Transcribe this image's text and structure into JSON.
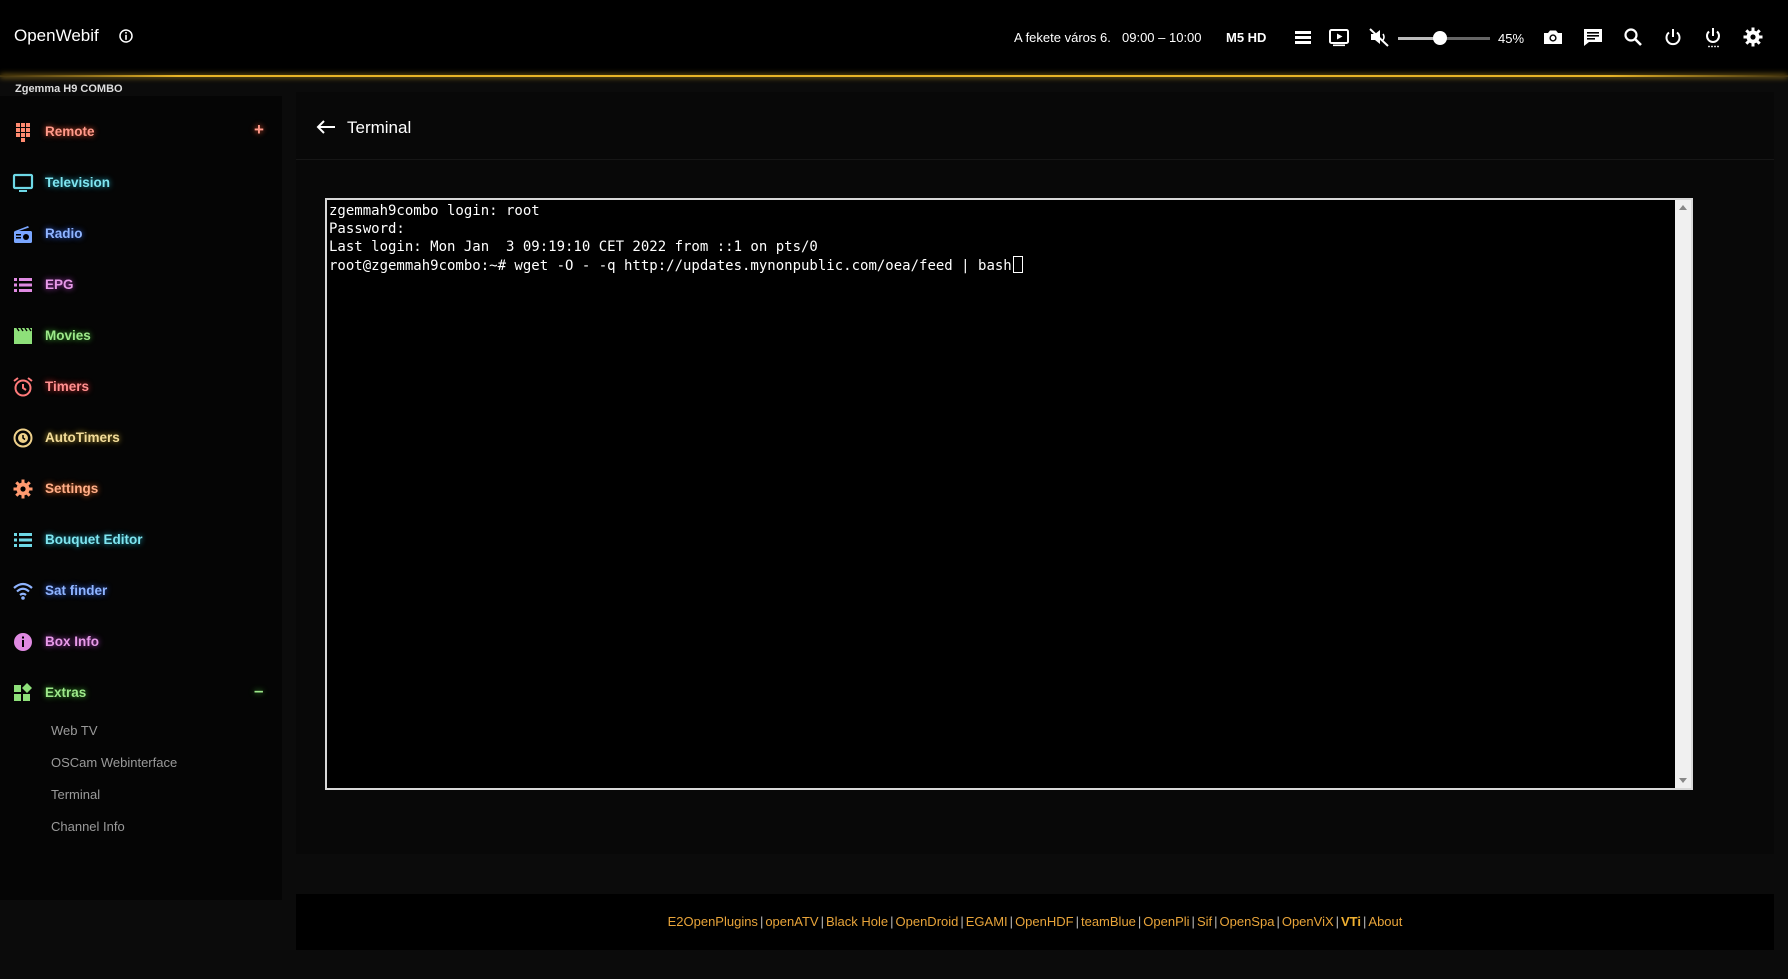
{
  "topbar": {
    "brand": "OpenWebif",
    "now_program": "A fekete város 6.",
    "now_time": "09:00 – 10:00",
    "channel": "M5 HD",
    "volume_percent": 45,
    "volume_label": "45%",
    "icons": [
      "info-icon",
      "list-icon",
      "play-screen-icon",
      "mute-icon",
      "camera-icon",
      "message-icon",
      "search-icon",
      "power-icon",
      "standby-icon",
      "settings-icon"
    ],
    "accent_color": "#e8b428"
  },
  "sidebar": {
    "box_name": "Zgemma H9 COMBO",
    "items": [
      {
        "label": "Remote",
        "color": "#ff9a8a",
        "sign": "+"
      },
      {
        "label": "Television",
        "color": "#7fe4ef",
        "sign": ""
      },
      {
        "label": "Radio",
        "color": "#8fb4ff",
        "sign": ""
      },
      {
        "label": "EPG",
        "color": "#e79ae8",
        "sign": ""
      },
      {
        "label": "Movies",
        "color": "#9de88a",
        "sign": ""
      },
      {
        "label": "Timers",
        "color": "#ff9090",
        "sign": ""
      },
      {
        "label": "AutoTimers",
        "color": "#f2dc9a",
        "sign": ""
      },
      {
        "label": "Settings",
        "color": "#ffae88",
        "sign": ""
      },
      {
        "label": "Bouquet Editor",
        "color": "#7fe4ef",
        "sign": ""
      },
      {
        "label": "Sat finder",
        "color": "#8fb4ff",
        "sign": ""
      },
      {
        "label": "Box Info",
        "color": "#e79ae8",
        "sign": ""
      },
      {
        "label": "Extras",
        "color": "#9de88a",
        "sign": "–"
      }
    ],
    "extras_sub": [
      "Web TV",
      "OSCam Webinterface",
      "Terminal",
      "Channel Info"
    ]
  },
  "main": {
    "title": "Terminal",
    "terminal_lines": [
      "zgemmah9combo login: root",
      "Password:",
      "Last login: Mon Jan  3 09:19:10 CET 2022 from ::1 on pts/0",
      "root@zgemmah9combo:~# wget -O - -q http://updates.mynonpublic.com/oea/feed | bash"
    ]
  },
  "footer": {
    "links": [
      "E2OpenPlugins",
      "openATV",
      "Black Hole",
      "OpenDroid",
      "EGAMI",
      "OpenHDF",
      "teamBlue",
      "OpenPli",
      "Sif",
      "OpenSpa",
      "OpenViX",
      "VTi",
      "About"
    ]
  }
}
